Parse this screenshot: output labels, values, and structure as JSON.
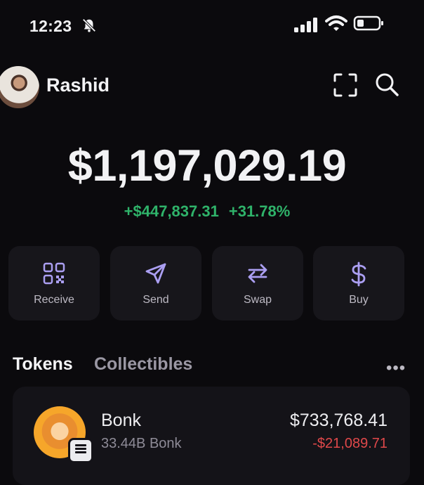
{
  "status_bar": {
    "time": "12:23",
    "icons": [
      "bell-off-icon",
      "cellular-signal-icon",
      "wifi-icon",
      "battery-icon"
    ]
  },
  "header": {
    "username": "Rashid",
    "icons": [
      "scan-icon",
      "search-icon"
    ]
  },
  "portfolio": {
    "balance": "$1,197,029.19",
    "change_value": "+$447,837.31",
    "change_percent": "+31.78%"
  },
  "actions": [
    {
      "label": "Receive",
      "icon": "qr-code-icon"
    },
    {
      "label": "Send",
      "icon": "send-icon"
    },
    {
      "label": "Swap",
      "icon": "swap-icon"
    },
    {
      "label": "Buy",
      "icon": "dollar-icon"
    }
  ],
  "tabs": {
    "tokens": "Tokens",
    "collectibles": "Collectibles",
    "more": "•••"
  },
  "tokens": [
    {
      "name": "Bonk",
      "amount": "33.44B Bonk",
      "value": "$733,768.41",
      "change": "-$21,089.71"
    }
  ],
  "colors": {
    "background": "#0b0a0d",
    "card": "#17161b",
    "accent": "#ab9ff2",
    "positive": "#2fb36a",
    "negative": "#e0484a"
  }
}
